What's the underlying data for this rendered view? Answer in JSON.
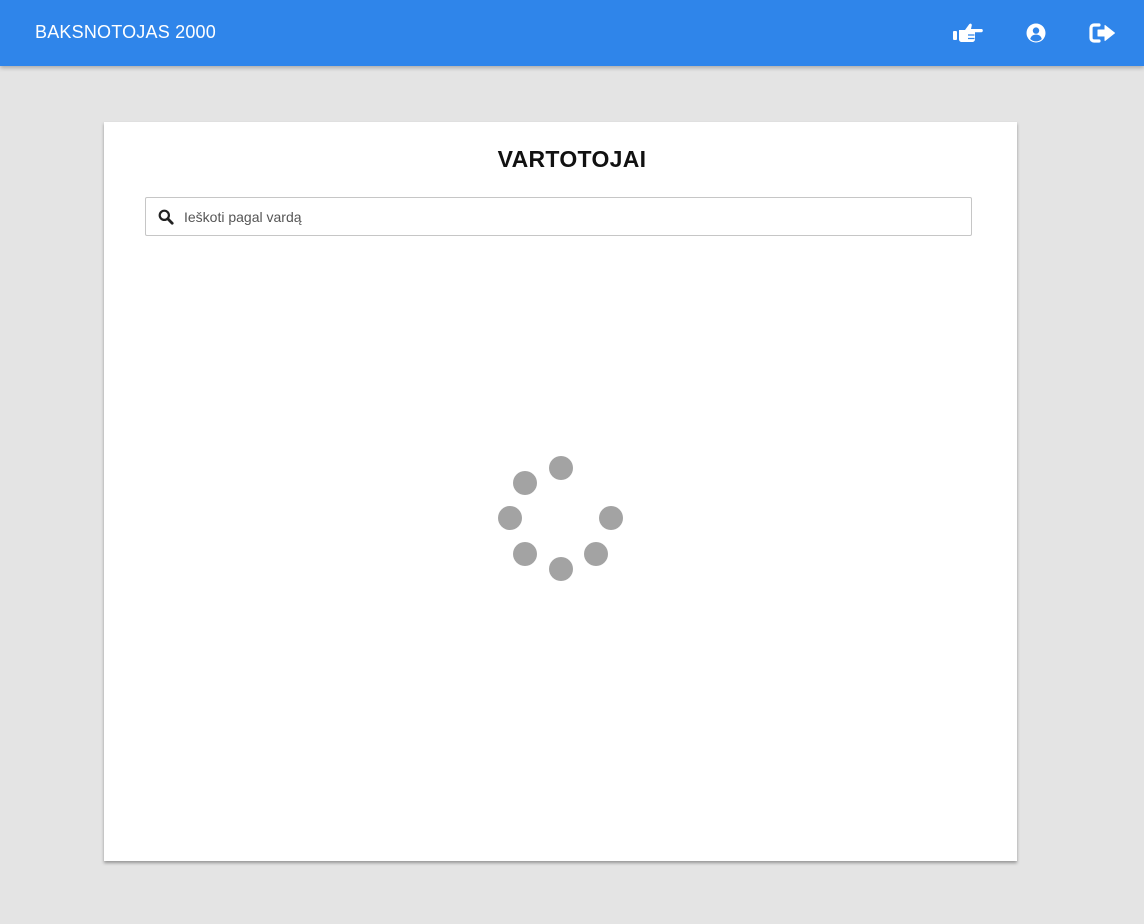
{
  "app": {
    "title": "BAKSNOTOJAS 2000"
  },
  "nav": {
    "icons": [
      "hand-pointer-icon",
      "user-circle-icon",
      "sign-out-icon"
    ]
  },
  "colors": {
    "appbar": "#2f85ea",
    "background": "#e4e4e4",
    "card": "#ffffff",
    "spinner_dot": "#a3a3a3"
  },
  "main": {
    "heading": "VARTOTOJAI",
    "search": {
      "placeholder": "Ieškoti pagal vardą",
      "value": "",
      "icon": "search-icon"
    },
    "loading": {
      "indicator": "spinner",
      "dot_count": 7
    }
  }
}
